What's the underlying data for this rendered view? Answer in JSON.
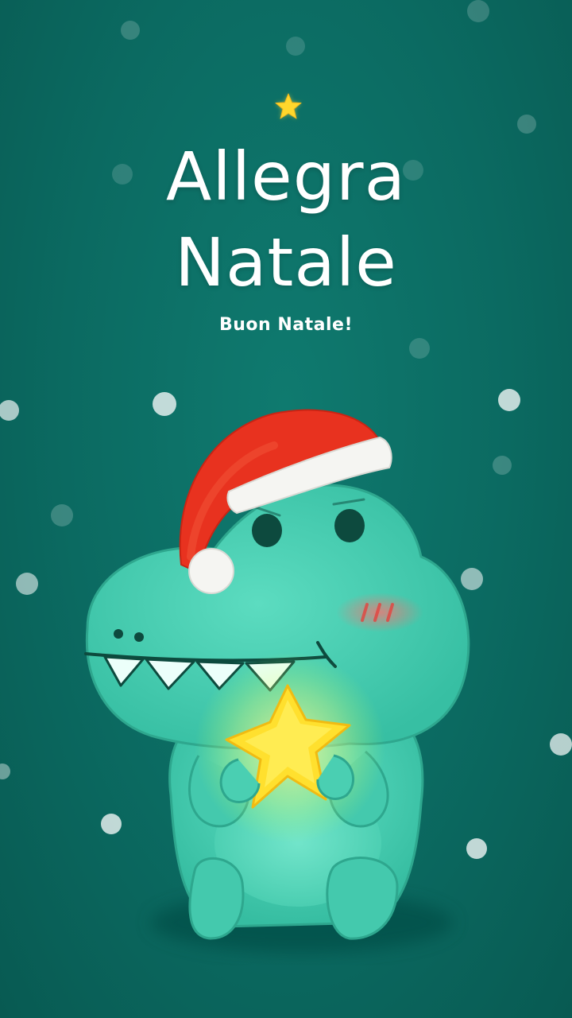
{
  "greeting": {
    "title_line1": "Allegra",
    "title_line2": "Natale",
    "subtitle": "Buon Natale!"
  },
  "colors": {
    "background": "#0b6b62",
    "dino_body": "#40cdb0",
    "hat_red": "#e8321f",
    "star_yellow": "#ffd92e"
  },
  "icons": {
    "top_decoration": "star-icon",
    "illustration": "dinosaur-with-santa-hat-holding-star"
  }
}
